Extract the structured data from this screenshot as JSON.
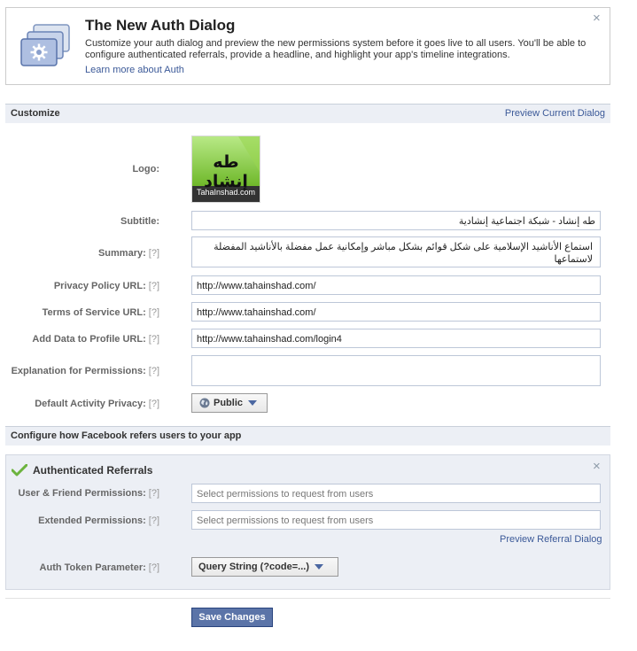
{
  "banner": {
    "title": "The New Auth Dialog",
    "description": "Customize your auth dialog and preview the new permissions system before it goes live to all users. You'll be able to configure authenticated referrals, provide a headline, and highlight your app's timeline integrations.",
    "learn_more": "Learn more about Auth",
    "close": "×"
  },
  "customize": {
    "header": "Customize",
    "preview_link": "Preview Current Dialog",
    "help": "[?]",
    "logo": {
      "label": "Logo:",
      "arabic_text": "طه إنشاد",
      "caption": "TahaInshad.com"
    },
    "subtitle": {
      "label": "Subtitle:",
      "value": "طه إنشاد - شبكة اجتماعية إنشادية"
    },
    "summary": {
      "label": "Summary:",
      "value": "استماع الأناشيد الإسلامية على شكل قوائم بشكل مباشر وإمكانية عمل مفضلة بالأناشيد المفضلة لاستماعها"
    },
    "privacy_url": {
      "label": "Privacy Policy URL:",
      "value": "http://www.tahainshad.com/"
    },
    "tos_url": {
      "label": "Terms of Service URL:",
      "value": "http://www.tahainshad.com/"
    },
    "add_data_url": {
      "label": "Add Data to Profile URL:",
      "value": "http://www.tahainshad.com/login4"
    },
    "explanation": {
      "label": "Explanation for Permissions:",
      "value": ""
    },
    "activity_privacy": {
      "label": "Default Activity Privacy:",
      "value": "Public"
    }
  },
  "configure": {
    "header": "Configure how Facebook refers users to your app",
    "auth_referrals_title": "Authenticated Referrals",
    "user_friend": {
      "label": "User & Friend Permissions:",
      "placeholder": "Select permissions to request from users"
    },
    "extended": {
      "label": "Extended Permissions:",
      "placeholder": "Select permissions to request from users"
    },
    "preview_link": "Preview Referral Dialog",
    "token_param": {
      "label": "Auth Token Parameter:",
      "value": "Query String (?code=...)"
    },
    "close": "×"
  },
  "save_label": "Save Changes",
  "colors": {
    "link": "#3b5998",
    "section_bg": "#eceff5",
    "button": "#5b74a8",
    "logo_green": "#7cc22b"
  }
}
